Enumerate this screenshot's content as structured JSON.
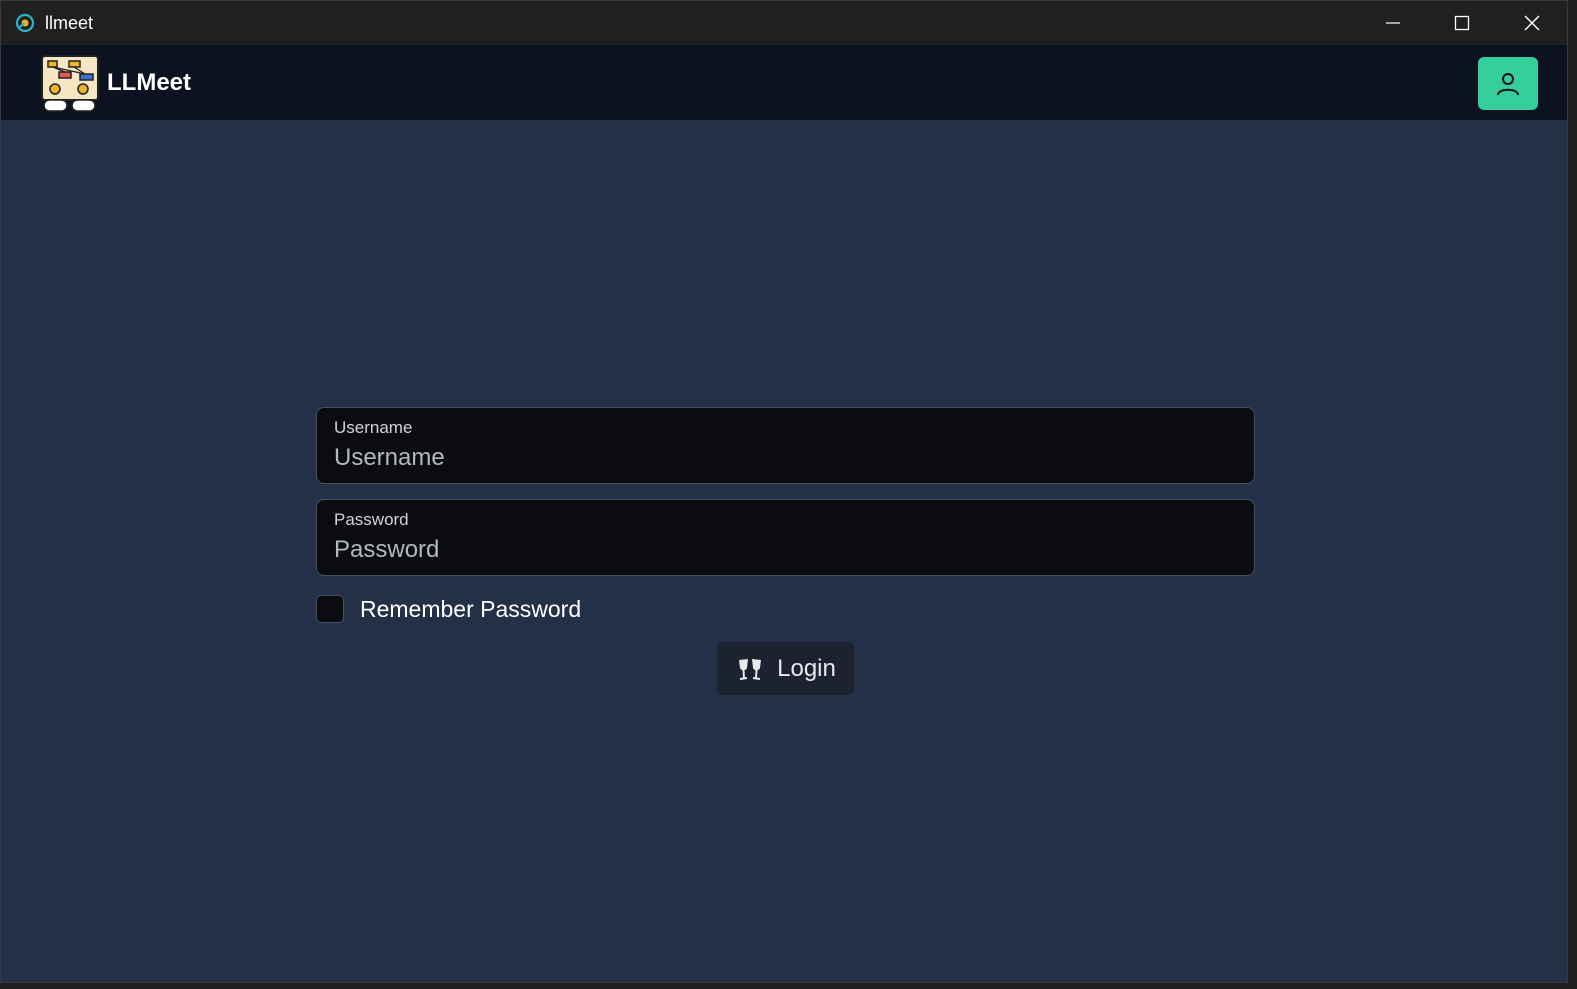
{
  "window": {
    "title": "llmeet",
    "controls": {
      "minimize_icon": "minimize-icon",
      "maximize_icon": "maximize-icon",
      "close_icon": "close-icon"
    }
  },
  "header": {
    "brand": "LLMeet",
    "logo_icon": "llmeet-logo",
    "user_button_icon": "user-icon",
    "accent_color": "#35cf9c",
    "background_color": "#0c1220"
  },
  "form": {
    "username": {
      "label": "Username",
      "placeholder": "Username",
      "value": ""
    },
    "password": {
      "label": "Password",
      "placeholder": "Password",
      "value": ""
    },
    "remember": {
      "label": "Remember Password",
      "checked": false
    },
    "login": {
      "label": "Login",
      "icon": "cheers-icon"
    }
  },
  "colors": {
    "page_background": "#242f48",
    "input_background": "#0b0c10"
  }
}
